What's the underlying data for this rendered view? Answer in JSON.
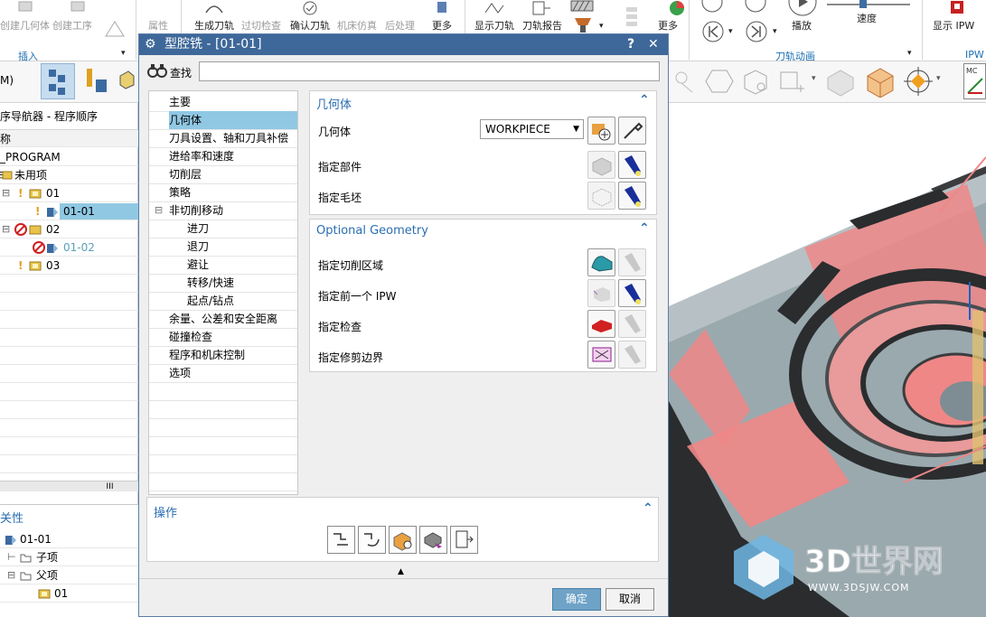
{
  "ribbon": {
    "create_geometry": "创建几何体",
    "create_method": "创建工序",
    "insert_group": "插入",
    "attribute": "属性",
    "generate_toolpath": "生成刀轨",
    "verify_overcut": "过切检查",
    "confirm_toolpath": "确认刀轨",
    "machine_sim": "机床仿真",
    "postprocess": "后处理",
    "more1": "更多",
    "show_toolpath": "显示刀轨",
    "toolpath_report": "刀轨报告",
    "more2": "更多",
    "play": "播放",
    "speed": "速度",
    "toolpath_anim_group": "刀轨动画",
    "show_ipw": "显示 IPW",
    "ipw_group": "IPW",
    "mode_label": "M)"
  },
  "navigator": {
    "title": "序导航器 - 程序顺序",
    "name_header": "称",
    "program_root": "_PROGRAM",
    "items": [
      {
        "label": "未用项"
      },
      {
        "label": "01"
      },
      {
        "label": "01-01"
      },
      {
        "label": "02"
      },
      {
        "label": "01-02"
      },
      {
        "label": "03"
      }
    ],
    "scroll_grip": "III",
    "dependencies_title": "关性",
    "dep_items": [
      {
        "label": "01-01"
      },
      {
        "label": "子项"
      },
      {
        "label": "父项"
      },
      {
        "label": "01"
      }
    ]
  },
  "dialog": {
    "title": "型腔铣 - [01-01]",
    "help": "?",
    "close": "✕",
    "find_label": "查找",
    "find_value": "",
    "tree": [
      {
        "label": "主要",
        "level": 0
      },
      {
        "label": "几何体",
        "level": 0
      },
      {
        "label": "刀具设置、轴和刀具补偿",
        "level": 0
      },
      {
        "label": "进给率和速度",
        "level": 0
      },
      {
        "label": "切削层",
        "level": 0
      },
      {
        "label": "策略",
        "level": 0
      },
      {
        "label": "非切削移动",
        "level": 0
      },
      {
        "label": "进刀",
        "level": 1
      },
      {
        "label": "退刀",
        "level": 1
      },
      {
        "label": "避让",
        "level": 1
      },
      {
        "label": "转移/快速",
        "level": 1
      },
      {
        "label": "起点/钻点",
        "level": 1
      },
      {
        "label": "余量、公差和安全距离",
        "level": 0
      },
      {
        "label": "碰撞检查",
        "level": 0
      },
      {
        "label": "程序和机床控制",
        "level": 0
      },
      {
        "label": "选项",
        "level": 0
      }
    ],
    "geometry_section": {
      "title": "几何体",
      "geometry_label": "几何体",
      "geometry_value": "WORKPIECE",
      "specify_part": "指定部件",
      "specify_blank": "指定毛坯"
    },
    "optional_section": {
      "title": "Optional Geometry",
      "cut_area": "指定切削区域",
      "prev_ipw": "指定前一个 IPW",
      "check": "指定检查",
      "trim_boundary": "指定修剪边界"
    },
    "operation_section": {
      "title": "操作"
    },
    "ok": "确定",
    "cancel": "取消"
  },
  "watermark": {
    "brand": "3D世界网",
    "url": "WWW.3DSJW.COM"
  },
  "colors": {
    "title_bar": "#3e6899",
    "selection": "#90c8e3",
    "section_title": "#2a6db1",
    "part_gray": "#8a9aa1",
    "overcut_pink": "#ef8787"
  }
}
